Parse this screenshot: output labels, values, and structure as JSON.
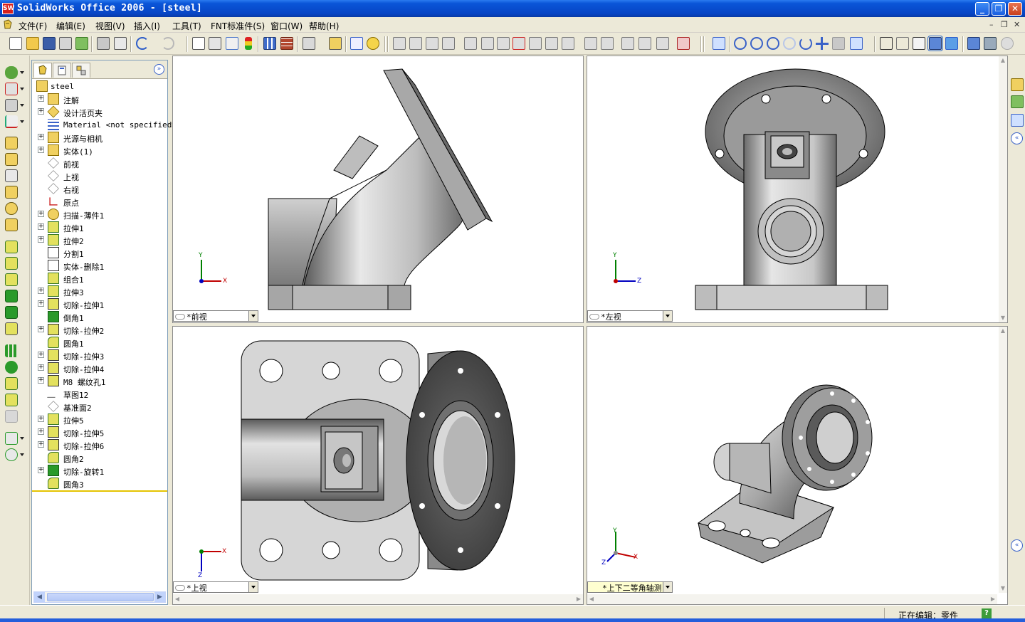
{
  "window": {
    "title": "SolidWorks Office 2006 - [steel]",
    "app_icon_text": "SW",
    "controls": {
      "minimize": "_",
      "restore": "❐",
      "close": "✕"
    }
  },
  "menubar": {
    "items": [
      "文件(F)",
      "编辑(E)",
      "视图(V)",
      "插入(I)",
      "工具(T)",
      "FNT标准件(S)",
      "窗口(W)",
      "帮助(H)"
    ],
    "doc_controls": {
      "minimize": "–",
      "restore": "❐",
      "close": "✕"
    }
  },
  "toolbar": {
    "icons": [
      "new-icon",
      "open-icon",
      "save-icon",
      "print-preview-icon",
      "rebuild-icon",
      "print-icon",
      "preview-icon",
      "undo-icon",
      "redo-icon",
      "select-icon",
      "smart-select-icon",
      "sketch-icon",
      "traffic-light-icon",
      "grid-icon",
      "brick-icon",
      "options-icon",
      "magic-icon",
      "properties-icon",
      "help-icon"
    ],
    "view_icons": [
      "zoom-fit-icon",
      "zoom-area-icon",
      "zoom-in-out-icon",
      "zoom-selection-icon",
      "rotate-icon",
      "pan-icon",
      "section-icon",
      "view-orientation-icon",
      "wireframe-icon",
      "hidden-lines-icon",
      "hidden-removed-icon",
      "shaded-edges-icon",
      "shaded-icon",
      "shadows-icon",
      "perspective-icon",
      "realview-icon"
    ]
  },
  "feature_manager": {
    "root": "steel",
    "items": [
      {
        "label": "注解",
        "icon": "annotations-icon",
        "expandable": true
      },
      {
        "label": "设计活页夹",
        "icon": "design-binder-icon",
        "expandable": true
      },
      {
        "label": "Material <not specified>",
        "icon": "material-icon",
        "expandable": false
      },
      {
        "label": "光源与相机",
        "icon": "lights-icon",
        "expandable": true
      },
      {
        "label": "实体(1)",
        "icon": "solid-bodies-icon",
        "expandable": true
      },
      {
        "label": "前视",
        "icon": "plane-icon",
        "expandable": false
      },
      {
        "label": "上视",
        "icon": "plane-icon",
        "expandable": false
      },
      {
        "label": "右视",
        "icon": "plane-icon",
        "expandable": false
      },
      {
        "label": "原点",
        "icon": "origin-icon",
        "expandable": false
      },
      {
        "label": "扫描-薄件1",
        "icon": "sweep-icon",
        "expandable": true
      },
      {
        "label": "拉伸1",
        "icon": "extrude-icon",
        "expandable": true
      },
      {
        "label": "拉伸2",
        "icon": "extrude-icon",
        "expandable": true
      },
      {
        "label": "分割1",
        "icon": "split-icon",
        "expandable": false
      },
      {
        "label": "实体-删除1",
        "icon": "body-delete-icon",
        "expandable": false
      },
      {
        "label": "组合1",
        "icon": "combine-icon",
        "expandable": false
      },
      {
        "label": "拉伸3",
        "icon": "extrude-icon",
        "expandable": true
      },
      {
        "label": "切除-拉伸1",
        "icon": "cut-extrude-icon",
        "expandable": true
      },
      {
        "label": "倒角1",
        "icon": "chamfer-icon",
        "expandable": false
      },
      {
        "label": "切除-拉伸2",
        "icon": "cut-extrude-icon",
        "expandable": true
      },
      {
        "label": "圆角1",
        "icon": "fillet-icon",
        "expandable": false
      },
      {
        "label": "切除-拉伸3",
        "icon": "cut-extrude-icon",
        "expandable": true
      },
      {
        "label": "切除-拉伸4",
        "icon": "cut-extrude-icon",
        "expandable": true
      },
      {
        "label": "M8 螺纹孔1",
        "icon": "hole-wizard-icon",
        "expandable": true
      },
      {
        "label": "草图12",
        "icon": "sketch-icon",
        "expandable": false
      },
      {
        "label": "基准面2",
        "icon": "plane-icon",
        "expandable": false
      },
      {
        "label": "拉伸5",
        "icon": "extrude-icon",
        "expandable": true
      },
      {
        "label": "切除-拉伸5",
        "icon": "cut-extrude-icon",
        "expandable": true
      },
      {
        "label": "切除-拉伸6",
        "icon": "cut-extrude-icon",
        "expandable": true
      },
      {
        "label": "圆角2",
        "icon": "fillet-icon",
        "expandable": false
      },
      {
        "label": "切除-旋转1",
        "icon": "cut-revolve-icon",
        "expandable": true
      },
      {
        "label": "圆角3",
        "icon": "fillet-icon",
        "expandable": false
      }
    ]
  },
  "viewports": {
    "front": "*前视",
    "left": "*左视",
    "top": "*上视",
    "iso": "*上下二等角轴测"
  },
  "triad": {
    "x": "X",
    "y": "Y",
    "z": "Z"
  },
  "statusbar": {
    "text": "正在编辑：零件",
    "help": "?"
  },
  "colors": {
    "titlebar": "#0a55d8",
    "part_gray": "#9a9a9a",
    "axis_x": "#c00000",
    "axis_y": "#008000",
    "axis_z": "#0000c0"
  }
}
